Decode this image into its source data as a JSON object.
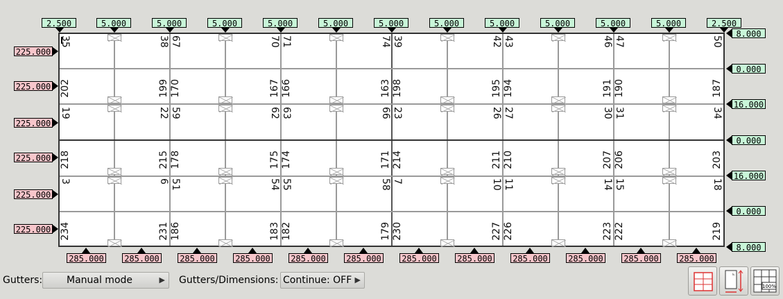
{
  "top_gutters": [
    "2.500",
    "5.000",
    "5.000",
    "5.000",
    "5.000",
    "5.000",
    "5.000",
    "5.000",
    "5.000",
    "5.000",
    "5.000",
    "5.000",
    "2.500"
  ],
  "right_gutters": [
    "8.000",
    "0.000",
    "16.000",
    "0.000",
    "16.000",
    "0.000",
    "8.000"
  ],
  "left_heights": [
    "225.000",
    "225.000",
    "225.000",
    "225.000",
    "225.000",
    "225.000"
  ],
  "bottom_widths": [
    "285.000",
    "285.000",
    "285.000",
    "285.000",
    "285.000",
    "285.000",
    "285.000",
    "285.000",
    "285.000",
    "285.000",
    "285.000",
    "285.000"
  ],
  "rows": [
    [
      "35",
      "38",
      "67",
      "70",
      "71",
      "74",
      "39",
      "42",
      "43",
      "46",
      "47",
      "50"
    ],
    [
      "202",
      "199",
      "170",
      "167",
      "166",
      "163",
      "198",
      "195",
      "194",
      "191",
      "190",
      "187"
    ],
    [
      "19",
      "22",
      "59",
      "62",
      "63",
      "66",
      "23",
      "26",
      "27",
      "30",
      "31",
      "34"
    ],
    [
      "218",
      "215",
      "178",
      "175",
      "174",
      "171",
      "214",
      "211",
      "210",
      "207",
      "206",
      "203"
    ],
    [
      "3",
      "6",
      "51",
      "54",
      "55",
      "58",
      "7",
      "10",
      "11",
      "14",
      "15",
      "18"
    ],
    [
      "234",
      "231",
      "186",
      "183",
      "182",
      "179",
      "230",
      "227",
      "226",
      "223",
      "222",
      "219"
    ]
  ],
  "controls": {
    "gutters_label": "Gutters:",
    "gutters_mode": "Manual mode",
    "dims_label": "Gutters/Dimensions:",
    "dims_value": "Continue: OFF"
  },
  "tools": [
    {
      "name": "grid-view-icon"
    },
    {
      "name": "page-size-icon"
    },
    {
      "name": "zoom-100-icon",
      "text": "100%"
    }
  ],
  "colors": {
    "green": "#c8f5d8",
    "pink": "#f7c6cb"
  }
}
